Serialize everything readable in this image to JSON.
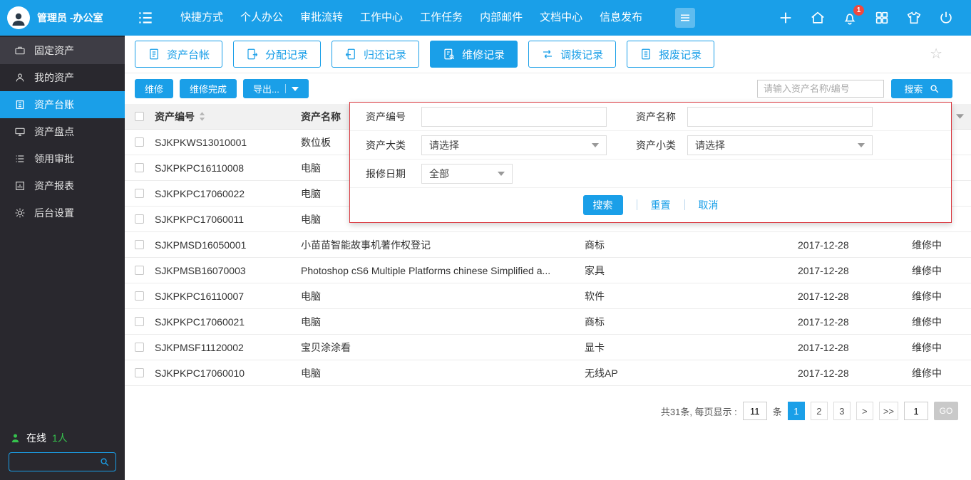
{
  "colors": {
    "accent": "#1a9fe8",
    "sidebar_bg": "#29282e",
    "panel_border": "#d9363e",
    "badge_red": "#f0483e",
    "online_green": "#35c24d"
  },
  "topbar": {
    "user_name": "管理员 -办公室",
    "nav": [
      "快捷方式",
      "个人办公",
      "审批流转",
      "工作中心",
      "工作任务",
      "内部邮件",
      "文档中心",
      "信息发布"
    ],
    "notification_badge": "1"
  },
  "sidebar": {
    "items": [
      {
        "label": "固定资产",
        "icon": "briefcase-icon"
      },
      {
        "label": "我的资产",
        "icon": "user-icon"
      },
      {
        "label": "资产台账",
        "icon": "ledger-icon"
      },
      {
        "label": "资产盘点",
        "icon": "monitor-icon"
      },
      {
        "label": "领用审批",
        "icon": "list-icon"
      },
      {
        "label": "资产报表",
        "icon": "report-icon"
      },
      {
        "label": "后台设置",
        "icon": "gear-icon"
      }
    ],
    "online_label": "在线",
    "online_count": "1人"
  },
  "tabs": [
    {
      "label": "资产台帐"
    },
    {
      "label": "分配记录"
    },
    {
      "label": "归还记录"
    },
    {
      "label": "维修记录"
    },
    {
      "label": "调拨记录"
    },
    {
      "label": "报废记录"
    }
  ],
  "toolbar": {
    "repair": "维修",
    "repair_done": "维修完成",
    "export": "导出...",
    "search_placeholder": "请输入资产名称/编号",
    "search": "搜索"
  },
  "filter_panel": {
    "asset_code_label": "资产编号",
    "asset_name_label": "资产名称",
    "category_label": "资产大类",
    "subcategory_label": "资产小类",
    "date_label": "报修日期",
    "category_value": "请选择",
    "subcategory_value": "请选择",
    "date_value": "全部",
    "search": "搜索",
    "reset": "重置",
    "cancel": "取消"
  },
  "table": {
    "headers": {
      "code": "资产编号",
      "name": "资产名称"
    },
    "rows": [
      {
        "code": "SJKPKWS13010001",
        "name": "数位板",
        "category": "",
        "date": "",
        "status": ""
      },
      {
        "code": "SJKPKPC16110008",
        "name": "电脑",
        "category": "",
        "date": "",
        "status": ""
      },
      {
        "code": "SJKPKPC17060022",
        "name": "电脑",
        "category": "",
        "date": "",
        "status": ""
      },
      {
        "code": "SJKPKPC17060011",
        "name": "电脑",
        "category": "",
        "date": "",
        "status": ""
      },
      {
        "code": "SJKPMSD16050001",
        "name": "小苗苗智能故事机著作权登记",
        "category": "商标",
        "date": "2017-12-28",
        "status": "维修中"
      },
      {
        "code": "SJKPMSB16070003",
        "name": "Photoshop cS6 Multiple Platforms chinese Simplified a...",
        "category": "家具",
        "date": "2017-12-28",
        "status": "维修中"
      },
      {
        "code": "SJKPKPC16110007",
        "name": "电脑",
        "category": "软件",
        "date": "2017-12-28",
        "status": "维修中"
      },
      {
        "code": "SJKPKPC17060021",
        "name": "电脑",
        "category": "商标",
        "date": "2017-12-28",
        "status": "维修中"
      },
      {
        "code": "SJKPMSF11120002",
        "name": "宝贝涂涂看",
        "category": "显卡",
        "date": "2017-12-28",
        "status": "维修中"
      },
      {
        "code": "SJKPKPC17060010",
        "name": "电脑",
        "category": "无线AP",
        "date": "2017-12-28",
        "status": "维修中"
      }
    ]
  },
  "pagination": {
    "summary": "共31条, 每页显示 :",
    "page_size": "11",
    "unit": "条",
    "pages": [
      "1",
      "2",
      "3"
    ],
    "next": ">",
    "last": ">>",
    "goto_value": "1",
    "go": "GO"
  }
}
